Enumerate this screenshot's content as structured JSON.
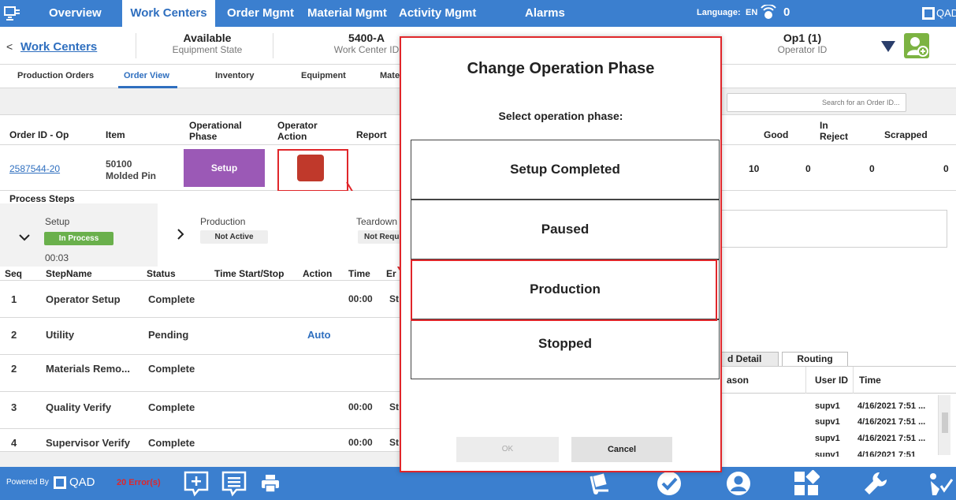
{
  "topnav": {
    "tabs": [
      "Overview",
      "Work Centers",
      "Order Mgmt",
      "Material Mgmt",
      "Activity Mgmt",
      "Alarms"
    ],
    "active_tab": "Work Centers",
    "language_label": "Language:",
    "language_value": "EN",
    "alarm_count": "0",
    "brand": "QAD"
  },
  "header": {
    "back_label": "<",
    "work_centers_link": "Work Centers",
    "equipment_state_value": "Available",
    "equipment_state_label": "Equipment State",
    "work_center_id_value": "5400-A",
    "work_center_id_label": "Work Center ID",
    "operator_id_value": "Op1 (1)",
    "operator_id_label": "Operator ID"
  },
  "subtabs": [
    "Production Orders",
    "Order View",
    "Inventory",
    "Equipment",
    "Mate"
  ],
  "active_subtab": "Order View",
  "search": {
    "placeholder": "Search for an Order ID..."
  },
  "orders_table": {
    "headers": {
      "order_id": "Order ID - Op",
      "item": "Item",
      "operational_phase_1": "Operational",
      "operational_phase_2": "Phase",
      "operator_action_1": "Operator",
      "operator_action_2": "Action",
      "report": "Report",
      "good": "Good",
      "in_reject_1": "In",
      "in_reject_2": "Reject",
      "scrapped": "Scrapped"
    },
    "row": {
      "order_id": "2587544-20",
      "item_number": "50100",
      "item_name": "Molded Pin",
      "phase": "Setup",
      "qty": "10",
      "good": "0",
      "in_reject": "0",
      "scrapped": "0"
    }
  },
  "process_steps": {
    "title": "Process Steps",
    "stages": [
      {
        "name": "Setup",
        "status": "In Process",
        "time": "00:03"
      },
      {
        "name": "Production",
        "status": "Not Active"
      },
      {
        "name": "Teardown",
        "status": "Not Requ"
      }
    ]
  },
  "steps_table": {
    "headers": {
      "seq": "Seq",
      "step_name": "StepName",
      "status": "Status",
      "time_start_stop": "Time Start/Stop",
      "action": "Action",
      "time": "Time",
      "extra": "Er"
    },
    "rows": [
      {
        "seq": "1",
        "step_name": "Operator Setup",
        "status": "Complete",
        "action": "",
        "time": "00:00",
        "extra": "St"
      },
      {
        "seq": "2",
        "step_name": "Utility",
        "status": "Pending",
        "action": "Auto",
        "time": "",
        "extra": ""
      },
      {
        "seq": "2",
        "step_name": "Materials Remo...",
        "status": "Complete",
        "action": "",
        "time": "",
        "extra": ""
      },
      {
        "seq": "3",
        "step_name": "Quality Verify",
        "status": "Complete",
        "action": "",
        "time": "00:00",
        "extra": "St"
      },
      {
        "seq": "4",
        "step_name": "Supervisor Verify",
        "status": "Complete",
        "action": "",
        "time": "00:00",
        "extra": "St"
      }
    ]
  },
  "right_panel": {
    "tabs": [
      "d Detail",
      "Routing"
    ],
    "headers": {
      "reason": "ason",
      "user_id": "User ID",
      "time": "Time"
    },
    "rows": [
      {
        "user": "supv1",
        "time": "4/16/2021 7:51 ..."
      },
      {
        "user": "supv1",
        "time": "4/16/2021 7:51 ..."
      },
      {
        "user": "supv1",
        "time": "4/16/2021 7:51 ..."
      },
      {
        "user": "supv1",
        "time": "4/16/2021 7:51"
      }
    ]
  },
  "footer": {
    "powered_by": "Powered By",
    "brand": "QAD",
    "errors": "20 Error(s)"
  },
  "modal": {
    "title": "Change Operation Phase",
    "subtitle": "Select operation phase:",
    "options": [
      "Setup Completed",
      "Paused",
      "Production",
      "Stopped"
    ],
    "ok_label": "OK",
    "cancel_label": "Cancel"
  },
  "colors": {
    "nav_blue": "#3b7fcf",
    "phase_purple": "#9b59b6",
    "action_red": "#c0392b",
    "highlight_red": "#e0262a",
    "in_process_green": "#6ab04c",
    "error_red": "#e0262a"
  }
}
